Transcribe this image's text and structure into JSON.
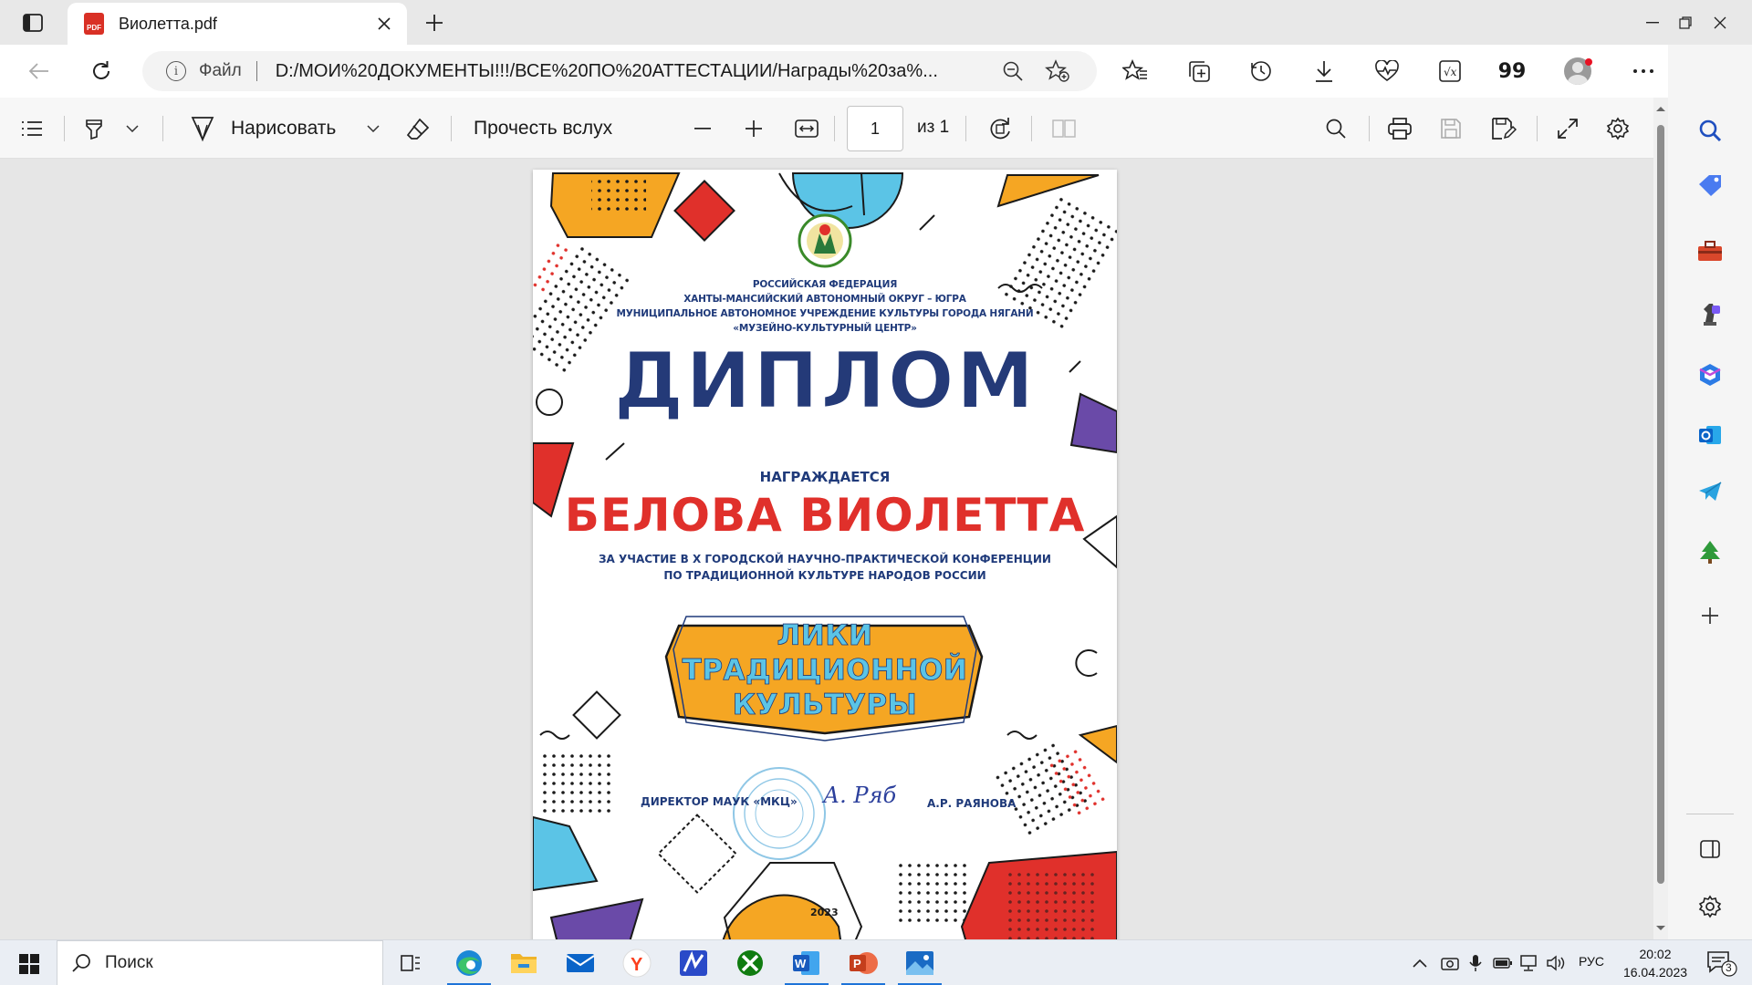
{
  "browser": {
    "tab": {
      "title": "Виолетта.pdf",
      "badge": "PDF"
    },
    "address": {
      "scheme_label": "Файл",
      "url": "D:/МОИ%20ДОКУМЕНТЫ!!!/ВСЕ%20ПО%20АТТЕСТАЦИИ/Награды%20за%..."
    },
    "toolbar_icons": [
      "favorites-star-icon",
      "collections-icon",
      "history-icon",
      "downloads-icon",
      "health-icon",
      "math-solver-icon",
      "quotes-icon",
      "profile-avatar",
      "more-icon"
    ],
    "quote_glyph": "99"
  },
  "pdf_toolbar": {
    "draw_label": "Нарисовать",
    "read_aloud_label": "Прочесть вслух",
    "page_current": "1",
    "page_of": "из 1"
  },
  "document": {
    "org_lines": [
      "РОССИЙСКАЯ ФЕДЕРАЦИЯ",
      "ХАНТЫ-МАНСИЙСКИЙ АВТОНОМНЫЙ ОКРУГ – ЮГРА",
      "МУНИЦИПАЛЬНОЕ АВТОНОМНОЕ УЧРЕЖДЕНИЕ КУЛЬТУРЫ ГОРОДА НЯГАНИ",
      "«МУЗЕЙНО-КУЛЬТУРНЫЙ ЦЕНТР»"
    ],
    "title": "ДИПЛОМ",
    "awarded_label": "НАГРАЖДАЕТСЯ",
    "recipient": "БЕЛОВА ВИОЛЕТТА",
    "reason_lines": [
      "ЗА УЧАСТИЕ В X ГОРОДСКОЙ НАУЧНО-ПРАКТИЧЕСКОЙ КОНФЕРЕНЦИИ",
      "ПО ТРАДИЦИОННОЙ КУЛЬТУРЕ НАРОДОВ РОССИИ"
    ],
    "badge_lines": [
      "ЛИКИ",
      "ТРАДИЦИОННОЙ",
      "КУЛЬТУРЫ"
    ],
    "signatory_title": "ДИРЕКТОР МАУК «МКЦ»",
    "signature": "А. Ряб",
    "signatory_name": "А.Р. РАЯНОВА",
    "year": "2023",
    "colors": {
      "navy": "#243a78",
      "red": "#e0302b",
      "orange": "#f5a623",
      "sky": "#5bc4e6",
      "purple": "#6a4aa8"
    }
  },
  "taskbar": {
    "search_placeholder": "Поиск",
    "apps": [
      "edge-icon",
      "file-explorer-icon",
      "mail-icon",
      "yandex-icon",
      "m-app-icon",
      "xbox-icon",
      "word-icon",
      "powerpoint-icon",
      "photos-icon"
    ],
    "language": "РУС",
    "time": "20:02",
    "date": "16.04.2023",
    "notification_count": "3"
  }
}
